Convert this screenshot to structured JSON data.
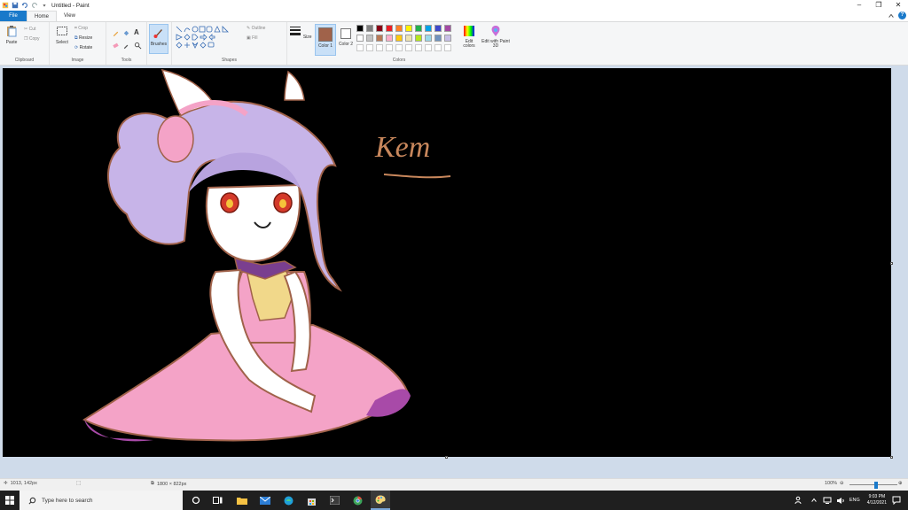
{
  "window": {
    "title": "Untitled - Paint",
    "minimize_glyph": "–",
    "maximize_glyph": "❐",
    "close_glyph": "✕"
  },
  "tabs": [
    {
      "label": "File"
    },
    {
      "label": "Home"
    },
    {
      "label": "View"
    }
  ],
  "ribbon": {
    "clipboard": {
      "label": "Clipboard",
      "paste": "Paste",
      "cut": "Cut",
      "copy": "Copy"
    },
    "image": {
      "label": "Image",
      "select": "Select",
      "crop": "Crop",
      "resize": "Resize",
      "rotate": "Rotate"
    },
    "tools": {
      "label": "Tools"
    },
    "brushes": {
      "label": "Brushes"
    },
    "shapes": {
      "label": "Shapes",
      "outline": "Outline",
      "fill": "Fill"
    },
    "size": {
      "label": "Size"
    },
    "color1": {
      "label": "Color 1",
      "value": "#a0624a"
    },
    "color2": {
      "label": "Color 2",
      "value": "#ffffff"
    },
    "colors": {
      "label": "Colors"
    },
    "edit_colors": "Edit colors",
    "edit_paint3d": "Edit with Paint 3D"
  },
  "palette": {
    "row1": [
      "#000000",
      "#7f7f7f",
      "#880015",
      "#ed1c24",
      "#ff7f27",
      "#fff200",
      "#22b14c",
      "#00a2e8",
      "#3f48cc",
      "#a349a4"
    ],
    "row2": [
      "#ffffff",
      "#c3c3c3",
      "#b97a57",
      "#ffaec9",
      "#ffc90e",
      "#efe4b0",
      "#b5e61d",
      "#99d9ea",
      "#7092be",
      "#c8bfe7"
    ]
  },
  "drawing": {
    "signature": "Kem"
  },
  "status": {
    "cursor": "1013, 142px",
    "size": "1800 × 822px",
    "zoom": "100%",
    "zoom_level": 0.55
  },
  "taskbar": {
    "search_placeholder": "Type here to search",
    "language": "ENG",
    "time": "9:03 PM",
    "date": "4/12/2021"
  }
}
